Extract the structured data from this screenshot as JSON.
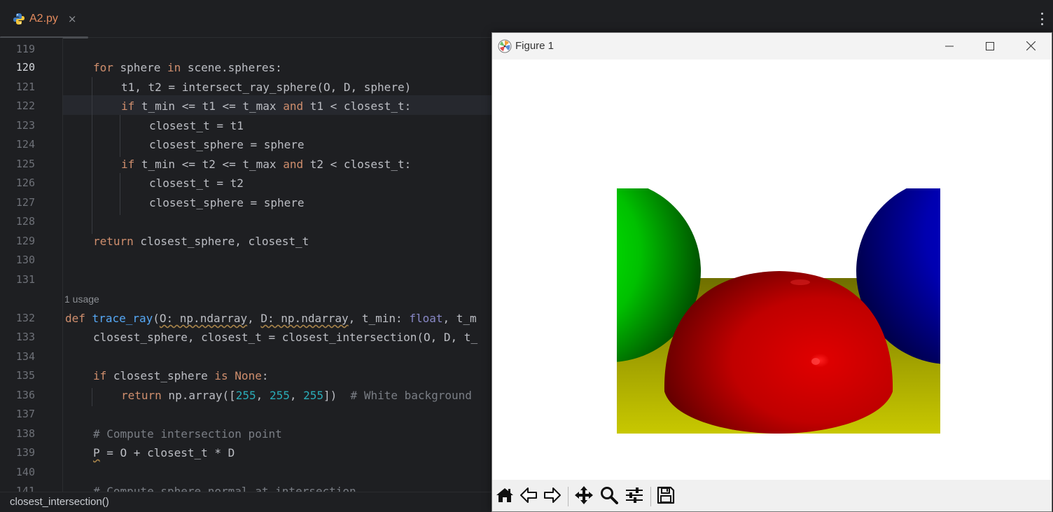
{
  "editor": {
    "tab": {
      "filename": "A2.py",
      "close_glyph": "×",
      "icon": "python-file-icon"
    },
    "menu_icon": "kebab-menu-icon",
    "current_line": "120",
    "line_numbers": [
      "119",
      "120",
      "121",
      "122",
      "123",
      "124",
      "125",
      "126",
      "127",
      "128",
      "129",
      "130",
      "131",
      "132",
      "133",
      "134",
      "135",
      "136",
      "137",
      "138",
      "139",
      "140",
      "141"
    ],
    "usage_hint": "1 usage",
    "code": {
      "l120": [
        "for",
        " sphere ",
        "in",
        " scene.spheres:"
      ],
      "l121": "t1, t2 = intersect_ray_sphere(O, D, sphere)",
      "l122": [
        "if",
        " t_min <= t1 <= t_max ",
        "and",
        " t1 < closest_t:"
      ],
      "l123": "closest_t = t1",
      "l124": "closest_sphere = sphere",
      "l125": [
        "if",
        " t_min <= t2 <= t_max ",
        "and",
        " t2 < closest_t:"
      ],
      "l126": "closest_t = t2",
      "l127": "closest_sphere = sphere",
      "l129": [
        "return",
        " closest_sphere, closest_t"
      ],
      "l132": [
        "def",
        "trace_ray",
        "(",
        "O: np.ndarray",
        ", ",
        "D: np.ndarray",
        ", t_min: ",
        "float",
        ", t_m"
      ],
      "l133": "closest_sphere, closest_t = closest_intersection(O, D, t_",
      "l135": [
        "if",
        " closest_sphere ",
        "is",
        "None",
        ":"
      ],
      "l136": [
        "return",
        " np.array([",
        "255",
        ", ",
        "255",
        ", ",
        "255",
        "])  ",
        "# White background"
      ],
      "l138": "# Compute intersection point",
      "l139": [
        "P",
        " = O + closest_t * D"
      ],
      "l141": "# Compute sphere normal at intersection"
    }
  },
  "status_bar": {
    "breadcrumb": "closest_intersection()"
  },
  "figure": {
    "title": "Figure 1",
    "logo_icon": "matplotlib-logo-icon",
    "window_buttons": [
      "minimize-icon",
      "maximize-icon",
      "close-icon"
    ],
    "render_colors": {
      "floor": "#c4c400",
      "red_sphere": "#cc0000",
      "green_sphere": "#00ee00",
      "blue_sphere": "#0000bb",
      "background": "#ffffff"
    },
    "toolbar": [
      "home-icon",
      "back-arrow-icon",
      "forward-arrow-icon",
      "pan-icon",
      "zoom-icon",
      "configure-subplots-icon",
      "save-icon"
    ]
  }
}
